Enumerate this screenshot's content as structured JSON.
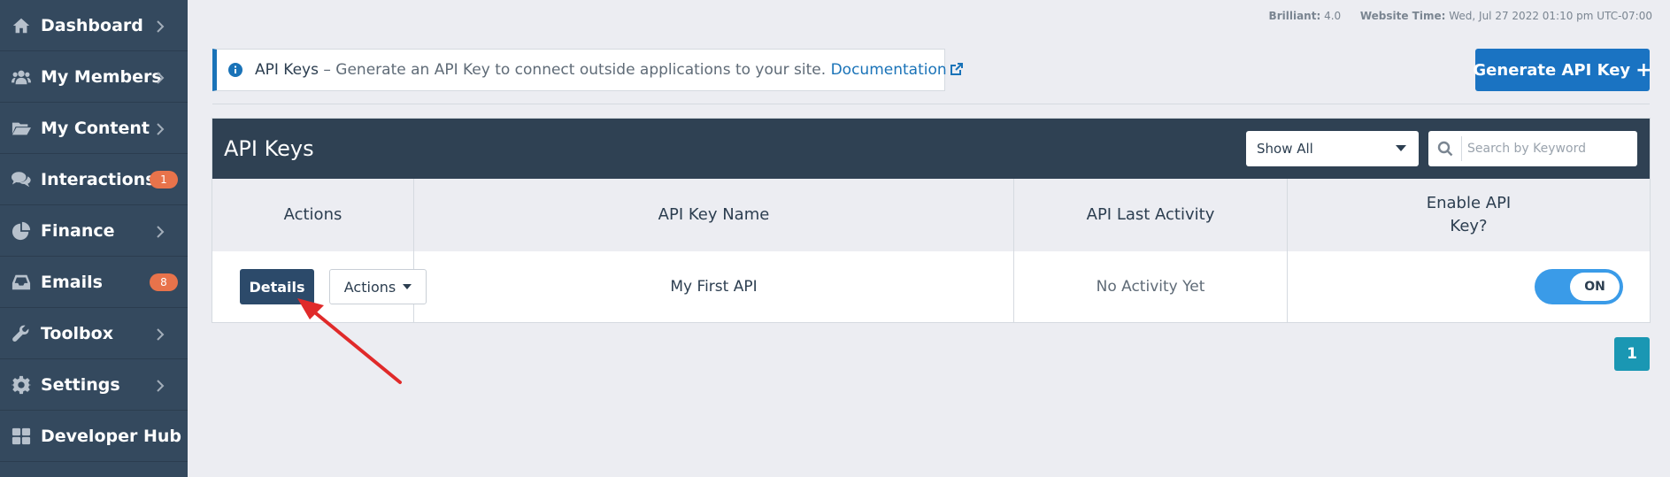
{
  "sidebar": {
    "items": [
      {
        "label": "Dashboard",
        "icon": "home-icon"
      },
      {
        "label": "My Members",
        "icon": "users-icon"
      },
      {
        "label": "My Content",
        "icon": "folder-open-icon"
      },
      {
        "label": "Interactions",
        "icon": "comments-icon",
        "badge": "1"
      },
      {
        "label": "Finance",
        "icon": "pie-chart-icon"
      },
      {
        "label": "Emails",
        "icon": "inbox-icon",
        "badge": "8"
      },
      {
        "label": "Toolbox",
        "icon": "wrench-icon"
      },
      {
        "label": "Settings",
        "icon": "gear-icon"
      },
      {
        "label": "Developer Hub",
        "icon": "grid-icon"
      }
    ]
  },
  "topinfo": {
    "version_label": "Brilliant:",
    "version_value": "4.0",
    "time_label": "Website Time:",
    "time_value": "Wed, Jul 27 2022 01:10 pm UTC-07:00"
  },
  "banner": {
    "title": "API Keys",
    "text": " – Generate an API Key to connect outside applications to your site. ",
    "link": "Documentation"
  },
  "generate_button": {
    "label": "Generate API Key",
    "icon": "plus-icon"
  },
  "panel": {
    "title": "API Keys",
    "filter": {
      "selected": "Show All"
    },
    "search": {
      "placeholder": "Search by Keyword",
      "value": ""
    }
  },
  "table": {
    "columns": [
      "Actions",
      "API Key Name",
      "API Last Activity",
      "Enable API Key?"
    ],
    "rows": [
      {
        "details_label": "Details",
        "actions_label": "Actions",
        "name": "My First API",
        "last_activity": "No Activity Yet",
        "enabled_label": "ON"
      }
    ]
  },
  "pagination": {
    "current": "1"
  },
  "colors": {
    "sidebar_bg": "#34495e",
    "header_bg": "#2f4153",
    "primary": "#1a73c2",
    "badge": "#e8734b",
    "toggle_on": "#3a9be8",
    "pagination": "#1a97b3",
    "annotation_arrow": "#e02a2a"
  }
}
